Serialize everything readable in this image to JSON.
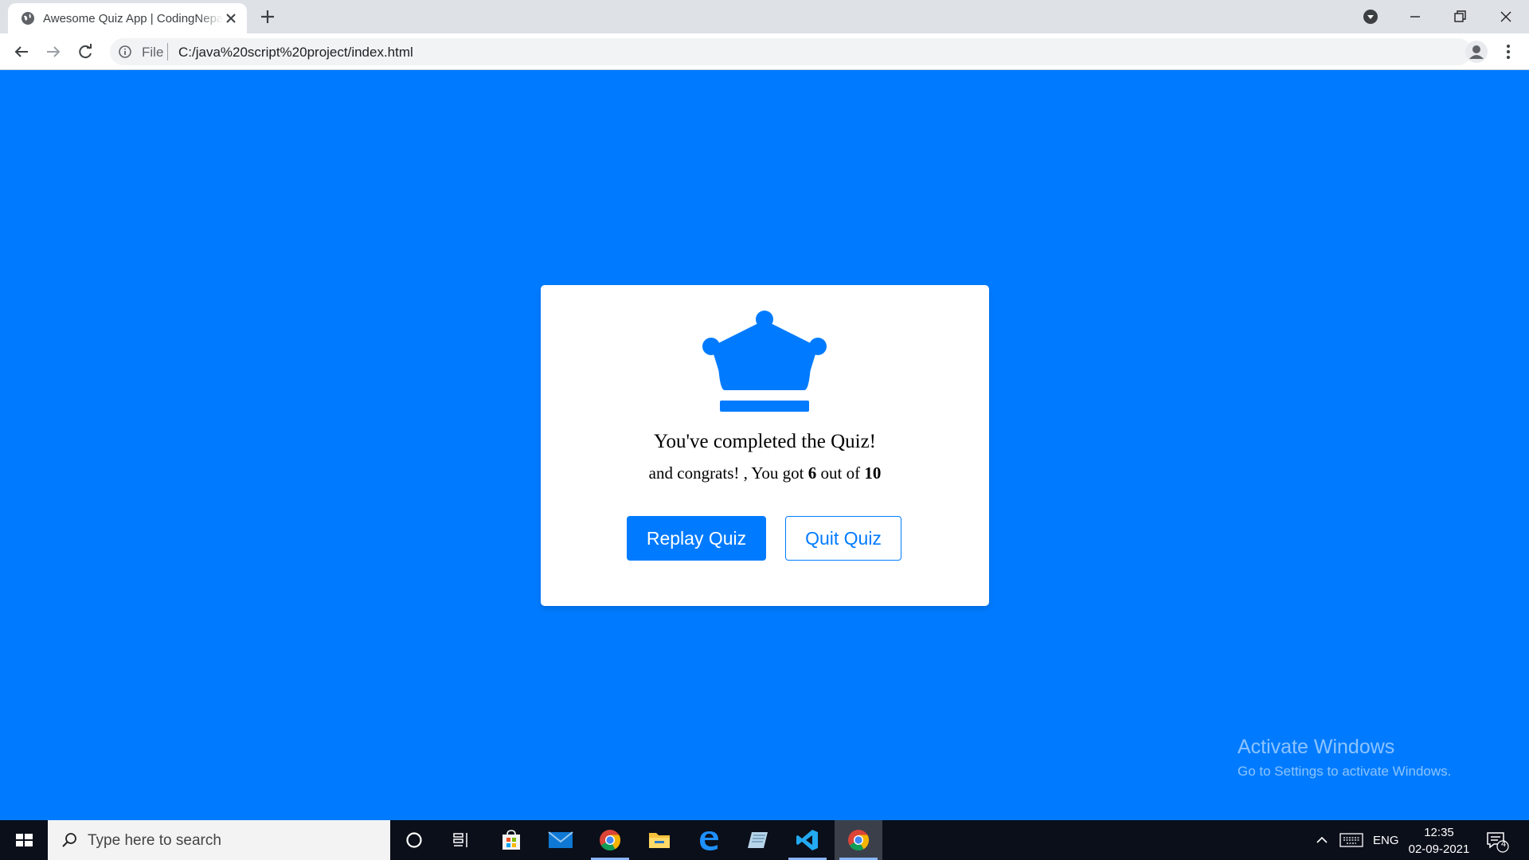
{
  "browser": {
    "tab_title": "Awesome Quiz App | CodingNepal",
    "address_scheme": "File",
    "address_url": "C:/java%20script%20project/index.html"
  },
  "page": {
    "background_color": "#007bff",
    "result": {
      "icon": "crown-icon",
      "complete_text": "You've completed the Quiz!",
      "score_prefix": "and congrats! , You got",
      "score_value": "6",
      "score_middle": "out of",
      "score_total": "10",
      "replay_button": "Replay Quiz",
      "quit_button": "Quit Quiz"
    },
    "watermark": {
      "title": "Activate Windows",
      "subtitle": "Go to Settings to activate Windows."
    }
  },
  "taskbar": {
    "search_placeholder": "Type here to search",
    "apps": [
      "cortana-icon",
      "task-view-icon",
      "store-icon",
      "mail-icon",
      "chrome-icon",
      "file-explorer-icon",
      "edge-icon",
      "notepad-icon",
      "vscode-icon",
      "chrome-active-icon"
    ],
    "language": "ENG",
    "time": "12:35",
    "date": "02-09-2021",
    "notification_count": "4"
  }
}
